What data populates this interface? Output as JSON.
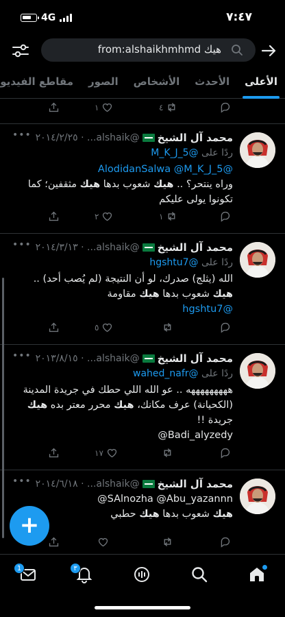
{
  "status": {
    "time": "٧:٤٧",
    "network": "4G"
  },
  "search": {
    "query": "from:alshaikhmhmd هيك"
  },
  "tabs": [
    {
      "label": "الأعلى",
      "active": true
    },
    {
      "label": "الأحدث",
      "active": false
    },
    {
      "label": "الأشخاص",
      "active": false
    },
    {
      "label": "الصور",
      "active": false
    },
    {
      "label": "مقاطع الفيديو",
      "active": false
    }
  ],
  "top_actions": {
    "likes": "١",
    "retweets": "٤"
  },
  "tweets": [
    {
      "author": "محمد آل الشيخ",
      "handle_date": "@alshaik... · ٢٠١٤/٢/٢٥",
      "reply_prefix": "ردًا على",
      "reply_to": "@M_K_J_5",
      "lines": [
        {
          "type": "link",
          "text": "@AlodidanSalwa @M_K_J_5"
        },
        {
          "type": "rich",
          "parts": [
            [
              "وراه ينتحر؟ .. ",
              false
            ],
            [
              "هيك",
              true
            ],
            [
              " شعوب بدها ",
              false
            ],
            [
              "هيك",
              true
            ],
            [
              " مثقفين؛ كما",
              false
            ]
          ]
        },
        {
          "type": "rich",
          "parts": [
            [
              "تكونوا يولى عليكم",
              false
            ]
          ]
        }
      ],
      "likes": "٢",
      "retweets": "١"
    },
    {
      "author": "محمد آل الشيخ",
      "handle_date": "@alshaik... · ٢٠١٤/٣/١٣",
      "reply_prefix": "ردًا على",
      "reply_to": "@hgshtu7",
      "lines": [
        {
          "type": "rich",
          "parts": [
            [
              "الله (يثلج) صدرك، لو أن النتيجة (لم يُصب أحد) ..",
              false
            ]
          ]
        },
        {
          "type": "rich",
          "parts": [
            [
              "هيك",
              true
            ],
            [
              " شعوب بدها ",
              false
            ],
            [
              "هيك",
              true
            ],
            [
              " مقاومة",
              false
            ]
          ]
        },
        {
          "type": "link",
          "text": "@hgshtu7"
        }
      ],
      "likes": "٥",
      "retweets": ""
    },
    {
      "author": "محمد آل الشيخ",
      "handle_date": "@alshaik... · ٢٠١٣/٨/١٥",
      "reply_prefix": "ردًا على",
      "reply_to": "@wahed_nafr",
      "lines": [
        {
          "type": "rich",
          "parts": [
            [
              "هههههههههه .. عو الله اللي حطك في جريدة المدينة",
              false
            ]
          ]
        },
        {
          "type": "rich",
          "parts": [
            [
              "(الكحيانة) عرف مكانك، ",
              false
            ],
            [
              "هيك",
              true
            ],
            [
              " محرر معتر بده ",
              false
            ],
            [
              "هيك",
              true
            ]
          ]
        },
        {
          "type": "rich",
          "parts": [
            [
              "جريدة !!",
              false
            ]
          ]
        },
        {
          "type": "rich",
          "parts": [
            [
              "Badi_alyzedy@",
              false
            ]
          ]
        }
      ],
      "likes": "١٧",
      "retweets": ""
    },
    {
      "author": "محمد آل الشيخ",
      "handle_date": "@alshaik... · ٢٠١٤/٦/١٨",
      "reply_prefix": "",
      "reply_to": "",
      "lines": [
        {
          "type": "rich",
          "parts": [
            [
              "SAlnozha @Abu_yazannn@",
              false
            ]
          ]
        },
        {
          "type": "rich",
          "parts": [
            [
              "هيك",
              true
            ],
            [
              " شعوب بدها ",
              false
            ],
            [
              "هيك",
              true
            ],
            [
              " حطبي",
              false
            ]
          ]
        }
      ],
      "likes": "",
      "retweets": ""
    }
  ],
  "bottom_nav": {
    "messages_badge": "1",
    "notifications_badge": "٣"
  },
  "colors": {
    "accent": "#1d9bf0",
    "background": "#000000",
    "muted": "#71767b"
  }
}
